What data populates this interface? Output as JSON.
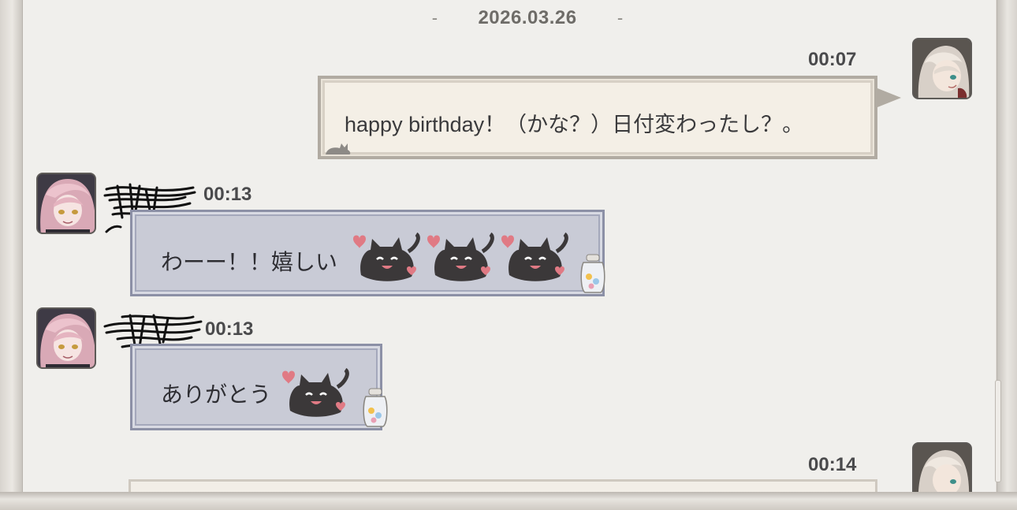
{
  "chat": {
    "date": "2026.03.26",
    "date_dash": "-",
    "messages": [
      {
        "sender": "self",
        "time": "00:07",
        "text": "happy birthday！（かな？）日付変わったし？。"
      },
      {
        "sender": "other",
        "time": "00:13",
        "text": "わーー！！嬉しい",
        "sticker_count": 3
      },
      {
        "sender": "other",
        "time": "00:13",
        "text": "ありがとう",
        "sticker_count": 1
      },
      {
        "sender": "self",
        "time": "00:14",
        "text": ""
      }
    ]
  },
  "colors": {
    "background": "#f0efec",
    "self_bubble": "#f4efe6",
    "other_bubble": "#c9cbd6"
  },
  "icons": {
    "sticker": "heart-cat-sticker",
    "jar": "candy-jar-icon"
  }
}
